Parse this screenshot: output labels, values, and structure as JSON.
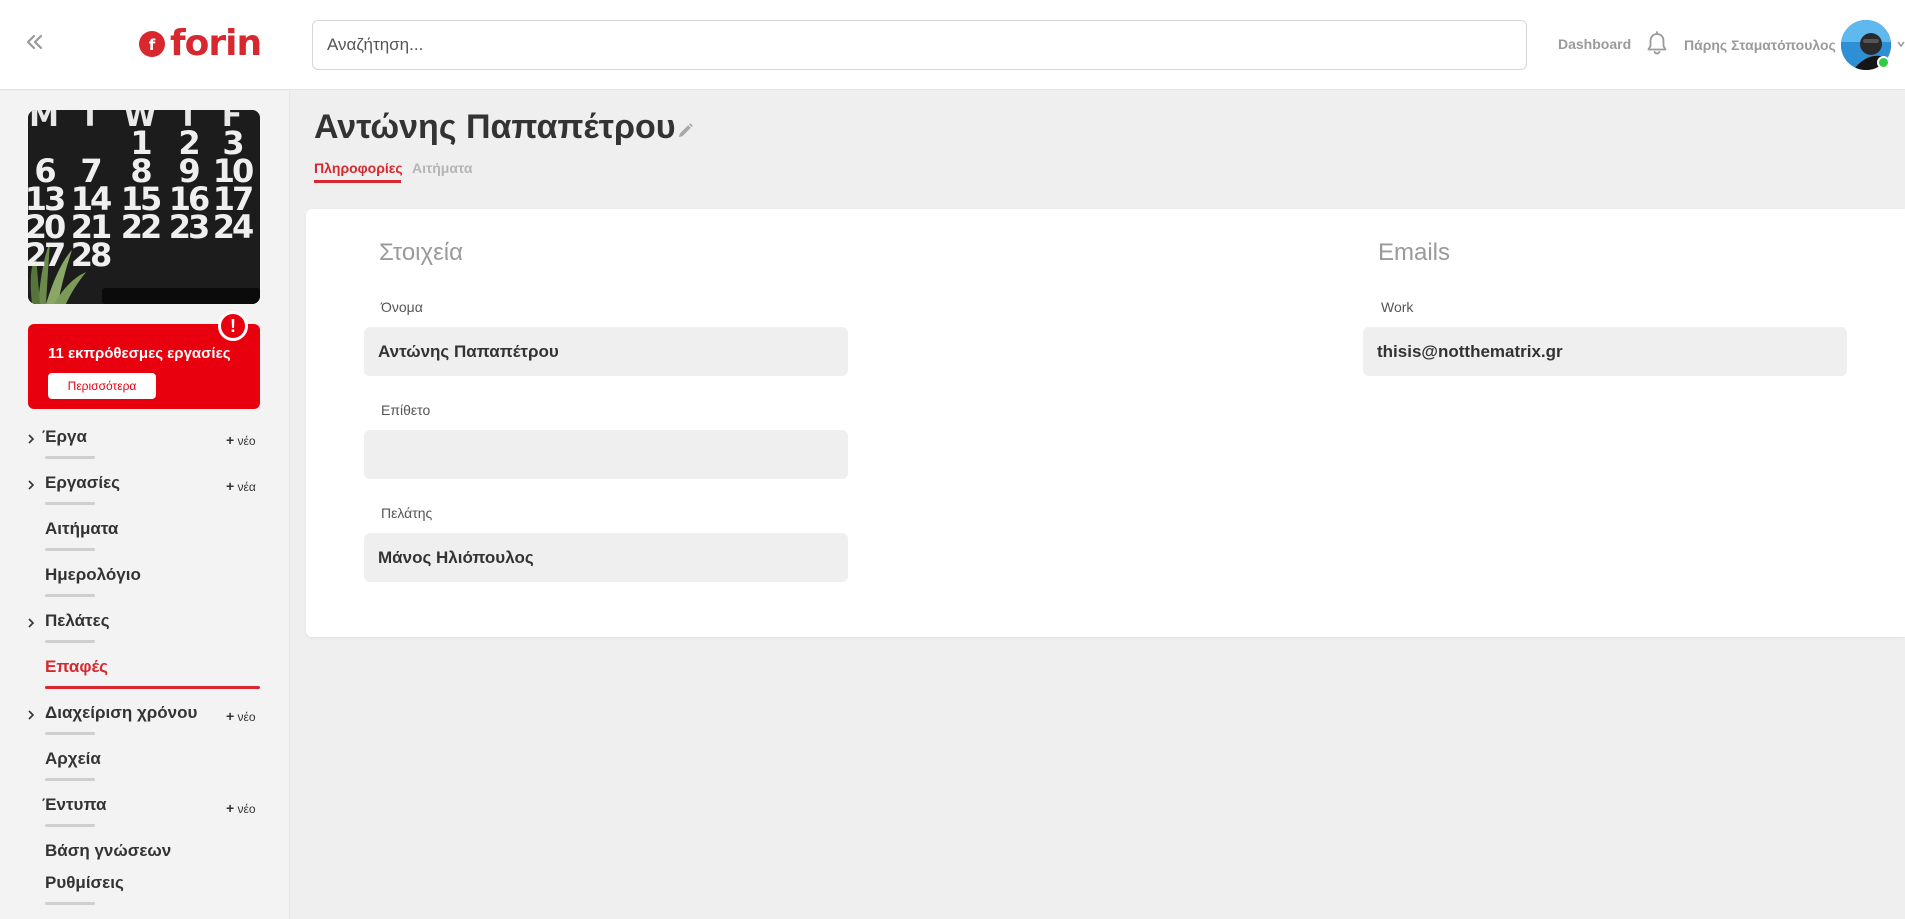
{
  "header": {
    "brand": "forin",
    "search_placeholder": "Αναζήτηση...",
    "dashboard_label": "Dashboard",
    "user_name": "Πάρης Σταματόπουλος",
    "online_color": "#2ecc40"
  },
  "sidebar": {
    "alert": {
      "text": "11 εκπρόθεσμες εργασίες",
      "button_label": "Περισσότερα",
      "badge": "!"
    },
    "items": [
      {
        "label": "Έργα",
        "add": "νέο",
        "expandable": true
      },
      {
        "label": "Εργασίες",
        "add": "νέα",
        "expandable": true
      },
      {
        "label": "Αιτήματα",
        "add": "",
        "expandable": false
      },
      {
        "label": "Ημερολόγιο",
        "add": "",
        "expandable": false
      },
      {
        "label": "Πελάτες",
        "add": "",
        "expandable": true
      },
      {
        "label": "Επαφές",
        "add": "",
        "expandable": false,
        "active": true
      },
      {
        "label": "Διαχείριση χρόνου",
        "add": "νέο",
        "expandable": true
      },
      {
        "label": "Αρχεία",
        "add": "",
        "expandable": false
      },
      {
        "label": "Έντυπα",
        "add": "νέο",
        "expandable": false
      },
      {
        "label": "Βάση γνώσεων",
        "add": "",
        "expandable": false
      },
      {
        "label": "Ρυθμίσεις",
        "add": "",
        "expandable": false
      }
    ],
    "calendar_image": {
      "letters": [
        "M",
        "T",
        "W",
        "T",
        "F"
      ],
      "rows": [
        [
          "",
          "",
          "1",
          "2",
          "3"
        ],
        [
          "6",
          "7",
          "8",
          "9",
          "10"
        ],
        [
          "13",
          "14",
          "15",
          "16",
          "17"
        ],
        [
          "20",
          "21",
          "22",
          "23",
          "24"
        ],
        [
          "27",
          "28",
          "",
          "",
          ""
        ]
      ]
    }
  },
  "main": {
    "title": "Αντώνης Παπαπέτρου",
    "tabs": [
      {
        "label": "Πληροφορίες",
        "active": true
      },
      {
        "label": "Αιτήματα",
        "active": false
      }
    ],
    "details": {
      "section_title": "Στοιχεία",
      "fields": [
        {
          "label": "Όνομα",
          "value": "Αντώνης Παπαπέτρου"
        },
        {
          "label": "Επίθετο",
          "value": ""
        },
        {
          "label": "Πελάτης",
          "value": "Μάνος Ηλιόπουλος"
        }
      ]
    },
    "emails": {
      "section_title": "Emails",
      "fields": [
        {
          "label": "Work",
          "value": "thisis@notthematrix.gr"
        }
      ]
    }
  },
  "colors": {
    "accent": "#d7282f",
    "alert_red": "#e8000f",
    "background": "#efefef"
  }
}
